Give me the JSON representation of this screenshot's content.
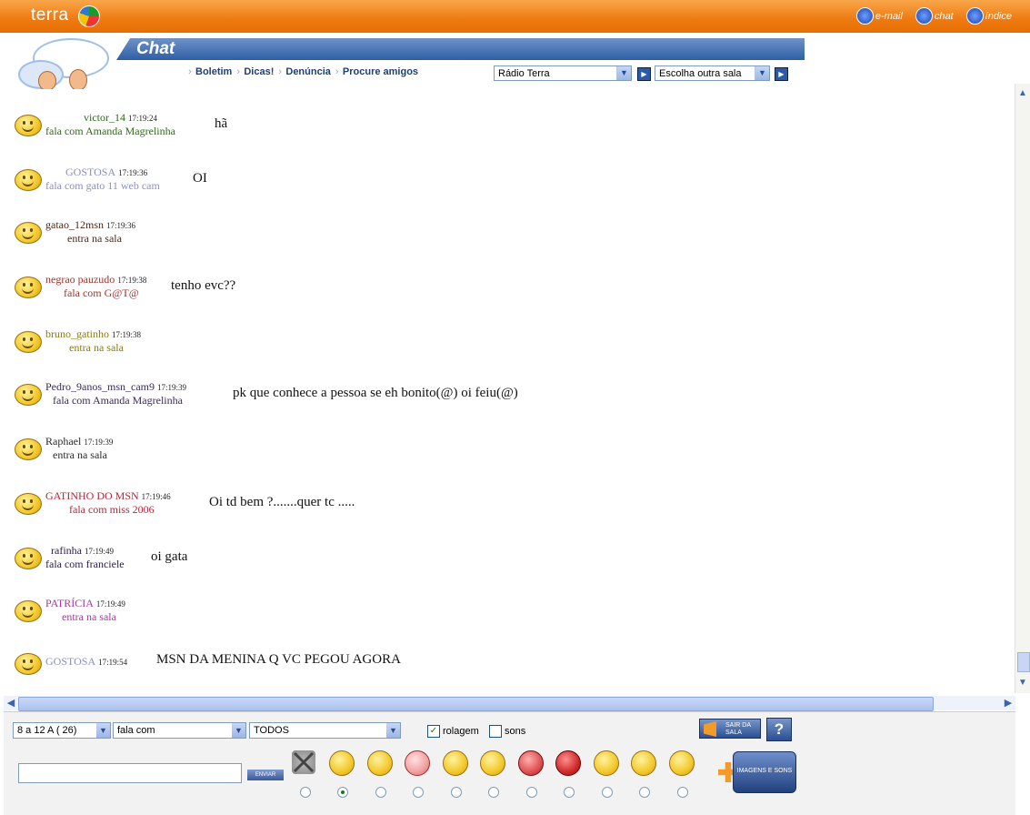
{
  "header": {
    "brand": "terra",
    "links": [
      {
        "label": "e-mail",
        "icon": "email-icon"
      },
      {
        "label": "chat",
        "icon": "chat-icon"
      },
      {
        "label": "índice",
        "icon": "index-icon"
      }
    ],
    "title": "Chat",
    "nav": [
      "Boletim",
      "Dicas!",
      "Denúncia",
      "Procure amigos"
    ],
    "radio_select": "Rádio Terra",
    "room_select": "Escolha outra sala"
  },
  "messages": [
    {
      "nick": "victor_14",
      "time": "17:19:24",
      "action": "fala com Amanda Magrelinha",
      "text": "hã",
      "color": "#2e6b16"
    },
    {
      "nick": "GOSTOSA",
      "time": "17:19:36",
      "action": "fala com gato 11 web cam",
      "text": "OI",
      "color": "#8a8fbf"
    },
    {
      "nick": "gatao_12msn",
      "time": "17:19:36",
      "action": "entra na sala",
      "text": "",
      "color": "#4a2a1a"
    },
    {
      "nick": "negrao pauzudo",
      "time": "17:19:38",
      "action": "fala com G@T@",
      "text": "tenho evc??",
      "color": "#a3322a"
    },
    {
      "nick": "bruno_gatinho",
      "time": "17:19:38",
      "action": "entra na sala",
      "text": "",
      "color": "#8a7a14"
    },
    {
      "nick": "Pedro_9anos_msn_cam9",
      "time": "17:19:39",
      "action": "fala com Amanda Magrelinha",
      "text": "pk que conhece a pessoa se eh bonito(@) oi feiu(@)",
      "color": "#3a2a5a"
    },
    {
      "nick": "Raphael",
      "time": "17:19:39",
      "action": "entra na sala",
      "text": "",
      "color": "#2a2a2a"
    },
    {
      "nick": "GATINHO DO MSN",
      "time": "17:19:46",
      "action": "fala com miss 2006",
      "text": "Oi td bem ?.......quer tc .....",
      "color": "#b0283a"
    },
    {
      "nick": "rafinha",
      "time": "17:19:49",
      "action": "fala com franciele",
      "text": "oi gata",
      "color": "#2a1a4a"
    },
    {
      "nick": "PATRÍCIA",
      "time": "17:19:49",
      "action": "entra na sala",
      "text": "",
      "color": "#a33a9a"
    },
    {
      "nick": "GOSTOSA",
      "time": "17:19:54",
      "action": "",
      "text": "MSN DA MENINA Q VC PEGOU AGORA",
      "color": "#8a8fbf"
    }
  ],
  "controls": {
    "room_count": "8 a 12 A ( 26)",
    "mode": "fala com",
    "target": "TODOS",
    "rolagem_label": "rolagem",
    "rolagem_checked": true,
    "sons_label": "sons",
    "sons_checked": false,
    "sair_label": "SAIR DA SALA",
    "help_label": "?",
    "message_value": "",
    "send_label": "ENVIAR",
    "images_label": "IMAGENS E SONS"
  },
  "emoticons": [
    {
      "name": "no-emoticon-icon",
      "selected": false
    },
    {
      "name": "smile-icon",
      "selected": true
    },
    {
      "name": "grin-icon",
      "selected": false
    },
    {
      "name": "blush-icon",
      "selected": false
    },
    {
      "name": "wink-icon",
      "selected": false
    },
    {
      "name": "tongue-icon",
      "selected": false
    },
    {
      "name": "angry-icon",
      "selected": false
    },
    {
      "name": "mad-icon",
      "selected": false
    },
    {
      "name": "surprised-icon",
      "selected": false
    },
    {
      "name": "sleepy-icon",
      "selected": false
    },
    {
      "name": "sad-icon",
      "selected": false
    }
  ]
}
